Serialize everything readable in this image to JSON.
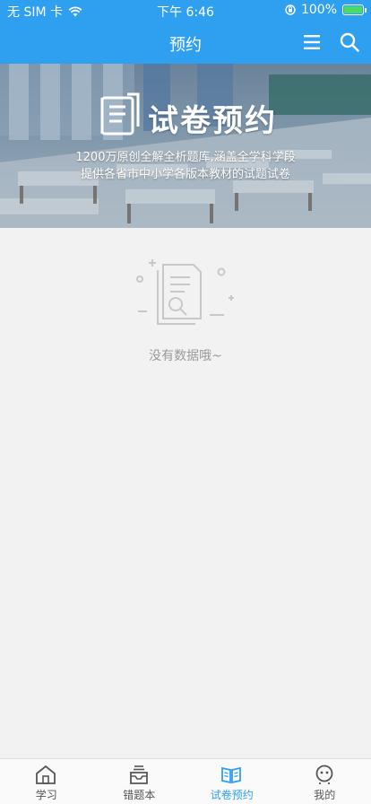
{
  "status_bar": {
    "carrier": "无 SIM 卡",
    "time": "下午 6:46",
    "battery": "100%"
  },
  "nav": {
    "title": "预约",
    "menu_icon": "menu-icon",
    "search_icon": "search-icon"
  },
  "banner": {
    "title": "试卷预约",
    "line1": "1200万原创全解全析题库,涵盖全学科学段",
    "line2": "提供各省市中小学各版本教材的试题试卷"
  },
  "empty_state": {
    "text": "没有数据哦~"
  },
  "tabbar": {
    "items": [
      {
        "label": "学习",
        "icon": "home-icon",
        "active": false
      },
      {
        "label": "错题本",
        "icon": "inbox-icon",
        "active": false
      },
      {
        "label": "试卷预约",
        "icon": "book-icon",
        "active": true
      },
      {
        "label": "我的",
        "icon": "profile-icon",
        "active": false
      }
    ]
  },
  "colors": {
    "primary": "#2f9ff0",
    "background": "#f2f2f2",
    "empty_text": "#9a9a9a"
  }
}
